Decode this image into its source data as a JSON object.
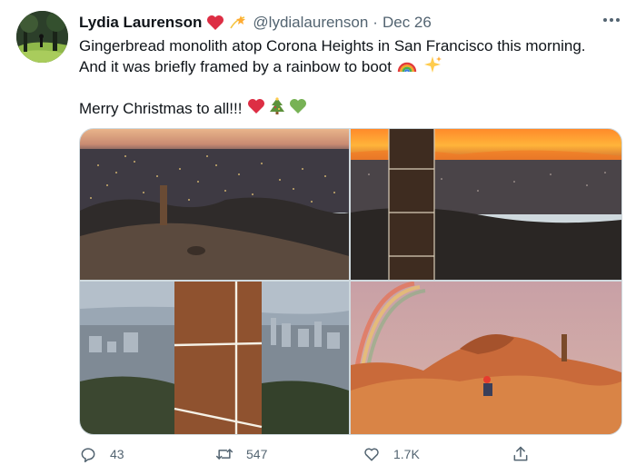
{
  "tweet": {
    "author_name": "Lydia Laurenson",
    "handle": "@lydialaurenson",
    "separator": "·",
    "date": "Dec 26",
    "text_line_1": "Gingerbread monolith atop Corona Heights in San Francisco this morning.",
    "text_line_2": "And it was briefly framed by a rainbow to boot",
    "text_line_3": "Merry Christmas to all!!!"
  },
  "photos": [
    {
      "name": "photo-city-lights-monolith",
      "description": "Gingerbread monolith at dusk overlooking San Francisco city lights"
    },
    {
      "name": "photo-monolith-sunset",
      "description": "Close-up of gingerbread monolith against an orange sunset sky"
    },
    {
      "name": "photo-monolith-closeup-skyline",
      "description": "Close-up of gingerbread monolith with icing, city skyline behind"
    },
    {
      "name": "photo-rainbow-rocks",
      "description": "Rainbow over rocky hill with monolith and person sitting"
    }
  ],
  "actions": {
    "replies": "43",
    "retweets": "547",
    "likes": "1.7K"
  },
  "colors": {
    "text": "#0f1419",
    "secondary": "#536471",
    "heart": "#e0245e",
    "green_heart": "#77b255",
    "border": "#cfd9de"
  },
  "icons": [
    "heart-emoji",
    "dizzy-star-emoji",
    "rainbow-emoji",
    "sparkles-emoji",
    "christmas-tree-emoji",
    "green-heart-emoji",
    "more-icon",
    "reply-icon",
    "retweet-icon",
    "like-icon",
    "share-icon"
  ]
}
